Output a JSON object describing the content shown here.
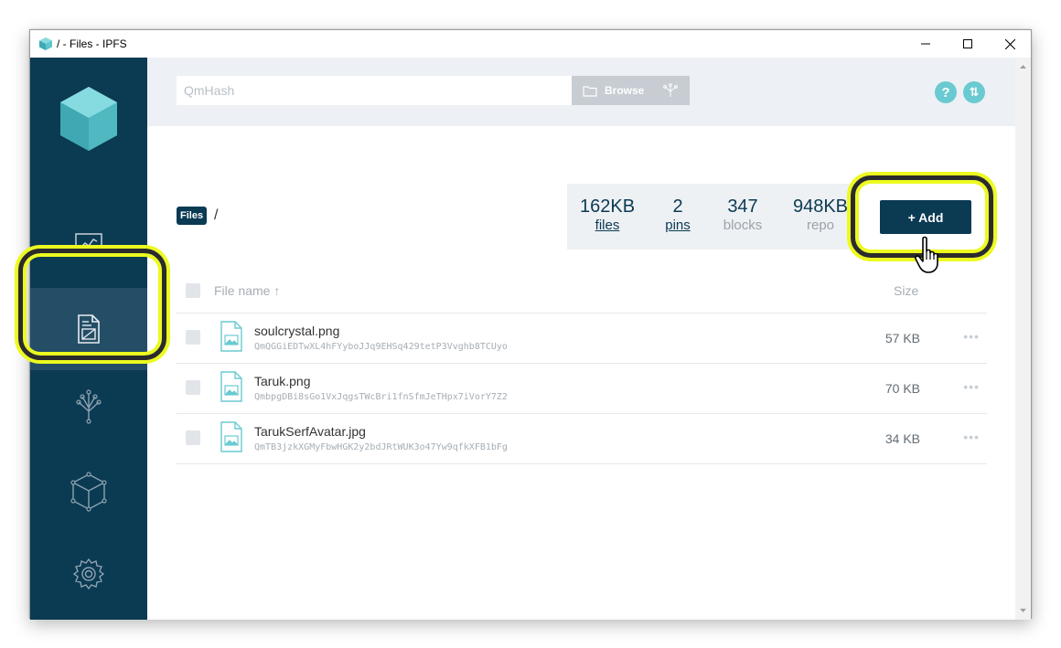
{
  "window": {
    "title": "/ - Files - IPFS"
  },
  "search": {
    "placeholder": "QmHash",
    "browse_label": "Browse"
  },
  "header": {
    "help_label": "?",
    "update_label": "⇅"
  },
  "breadcrumb": {
    "root": "Files",
    "separator": "/"
  },
  "stats": [
    {
      "value": "162KB",
      "label": "files",
      "link": true
    },
    {
      "value": "2",
      "label": "pins",
      "link": true
    },
    {
      "value": "347",
      "label": "blocks",
      "link": false
    },
    {
      "value": "948KB",
      "label": "repo",
      "link": false
    }
  ],
  "add_button": {
    "label": "+ Add"
  },
  "table": {
    "col_name": "File name ↑",
    "col_size": "Size",
    "rows": [
      {
        "name": "soulcrystal.png",
        "hash": "QmQGGiEDTwXL4hFYyboJJq9EHSq429tetP3Vvghb8TCUyo",
        "size": "57 KB",
        "more": "•••"
      },
      {
        "name": "Taruk.png",
        "hash": "QmbpgDBi8sGo1VxJqgsTWcBri1fnSfmJeTHpx7iVorY7Z2",
        "size": "70 KB",
        "more": "•••"
      },
      {
        "name": "TarukSerfAvatar.jpg",
        "hash": "QmTB3jzkXGMyFbwHGK2y2bdJRtWUK3o47Yw9qfkXFB1bFg",
        "size": "34 KB",
        "more": "•••"
      }
    ]
  },
  "colors": {
    "sidebar": "#0b3a53",
    "accent": "#6acad1",
    "highlight": "#ecfa1f"
  },
  "icons": [
    "ipfs-cube-logo",
    "status-icon",
    "files-icon",
    "explore-icon",
    "peers-icon",
    "settings-icon",
    "folder-icon",
    "image-file-icon"
  ]
}
